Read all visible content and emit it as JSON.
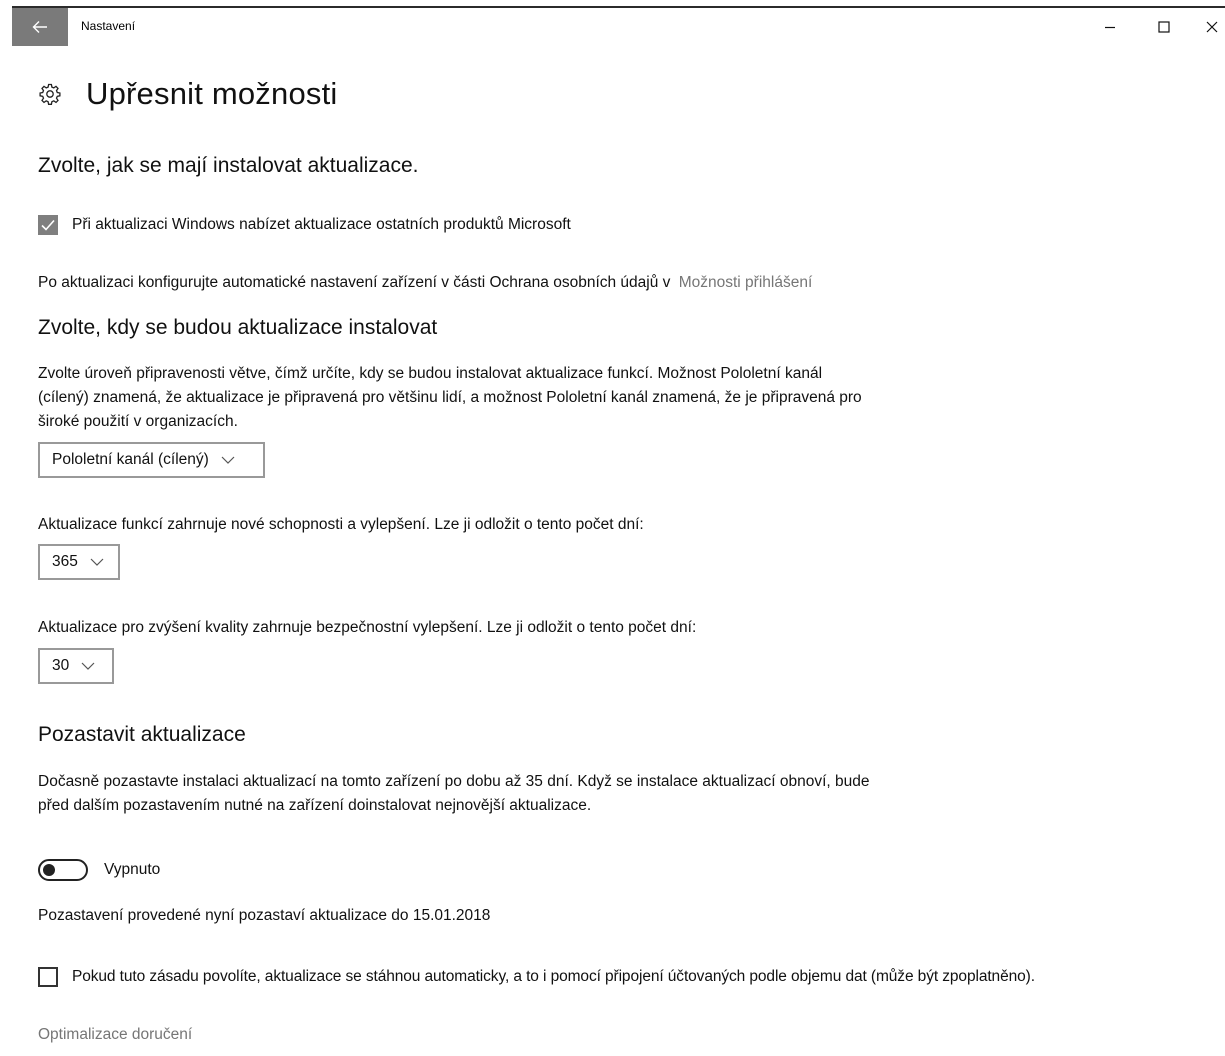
{
  "window": {
    "title": "Nastavení"
  },
  "page": {
    "title": "Upřesnit možnosti"
  },
  "install_section": {
    "heading": "Zvolte, jak se mají instalovat aktualizace.",
    "offer_other_products": {
      "label": "Při aktualizaci Windows nabízet aktualizace ostatních produktů Microsoft",
      "checked": true
    },
    "privacy_text": "Po aktualizaci konfigurujte automatické nastavení zařízení v části Ochrana osobních údajů v",
    "privacy_link": "Možnosti přihlášení"
  },
  "when_section": {
    "heading": "Zvolte, kdy se budou aktualizace instalovat",
    "description_line1": "Zvolte úroveň připravenosti větve, čímž určíte, kdy se budou instalovat aktualizace funkcí. Možnost Pololetní kanál",
    "description_line2": "(cílený) znamená, že aktualizace je připravená pro většinu lidí, a možnost Pololetní kanál znamená, že je připravená pro",
    "description_line3": "široké použití v organizacích.",
    "branch_select": {
      "value": "Pololetní kanál (cílený)"
    },
    "feature_defer_text": "Aktualizace funkcí zahrnuje nové schopnosti a vylepšení. Lze ji odložit o tento počet dní:",
    "feature_defer_select": {
      "value": "365"
    },
    "quality_defer_text": "Aktualizace pro zvýšení kvality zahrnuje bezpečnostní vylepšení. Lze ji odložit o tento počet dní:",
    "quality_defer_select": {
      "value": "30"
    }
  },
  "pause_section": {
    "heading": "Pozastavit aktualizace",
    "description_line1": "Dočasně pozastavte instalaci aktualizací na tomto zařízení po dobu až 35 dní. Když se instalace aktualizací obnoví, bude",
    "description_line2": "před dalším pozastavením nutné na zařízení doinstalovat nejnovější aktualizace.",
    "toggle": {
      "label": "Vypnuto",
      "on": false
    },
    "pause_until_text": "Pozastavení provedené nyní pozastaví aktualizace do 15.01.2018"
  },
  "metered": {
    "label": "Pokud tuto zásadu povolíte, aktualizace se stáhnou automaticky, a to i pomocí připojení účtovaných podle objemu dat (může být zpoplatněno).",
    "checked": false
  },
  "delivery_link": "Optimalizace doručení",
  "icons": {
    "back": "back-arrow-icon",
    "header": "gear-icon",
    "minimize": "minimize-icon",
    "maximize": "maximize-icon",
    "close": "close-icon",
    "check": "checkmark-icon",
    "dropdown": "chevron-down-icon"
  },
  "colors": {
    "back_button": "#7a7a7a",
    "checkbox_checked": "#7f7f7f",
    "link": "#767676"
  }
}
